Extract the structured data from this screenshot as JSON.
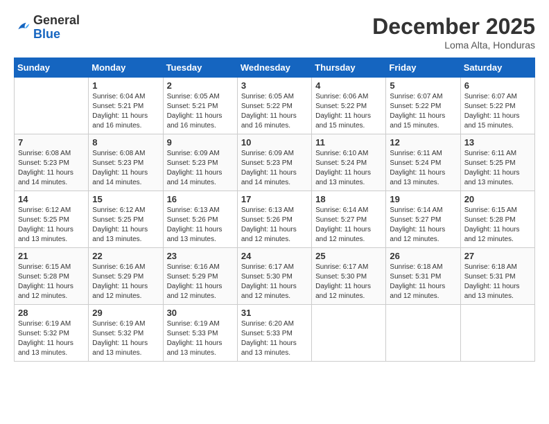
{
  "header": {
    "logo_general": "General",
    "logo_blue": "Blue",
    "month_year": "December 2025",
    "location": "Loma Alta, Honduras"
  },
  "weekdays": [
    "Sunday",
    "Monday",
    "Tuesday",
    "Wednesday",
    "Thursday",
    "Friday",
    "Saturday"
  ],
  "weeks": [
    [
      {
        "day": "",
        "info": ""
      },
      {
        "day": "1",
        "info": "Sunrise: 6:04 AM\nSunset: 5:21 PM\nDaylight: 11 hours and 16 minutes."
      },
      {
        "day": "2",
        "info": "Sunrise: 6:05 AM\nSunset: 5:21 PM\nDaylight: 11 hours and 16 minutes."
      },
      {
        "day": "3",
        "info": "Sunrise: 6:05 AM\nSunset: 5:22 PM\nDaylight: 11 hours and 16 minutes."
      },
      {
        "day": "4",
        "info": "Sunrise: 6:06 AM\nSunset: 5:22 PM\nDaylight: 11 hours and 15 minutes."
      },
      {
        "day": "5",
        "info": "Sunrise: 6:07 AM\nSunset: 5:22 PM\nDaylight: 11 hours and 15 minutes."
      },
      {
        "day": "6",
        "info": "Sunrise: 6:07 AM\nSunset: 5:22 PM\nDaylight: 11 hours and 15 minutes."
      }
    ],
    [
      {
        "day": "7",
        "info": "Sunrise: 6:08 AM\nSunset: 5:23 PM\nDaylight: 11 hours and 14 minutes."
      },
      {
        "day": "8",
        "info": "Sunrise: 6:08 AM\nSunset: 5:23 PM\nDaylight: 11 hours and 14 minutes."
      },
      {
        "day": "9",
        "info": "Sunrise: 6:09 AM\nSunset: 5:23 PM\nDaylight: 11 hours and 14 minutes."
      },
      {
        "day": "10",
        "info": "Sunrise: 6:09 AM\nSunset: 5:23 PM\nDaylight: 11 hours and 14 minutes."
      },
      {
        "day": "11",
        "info": "Sunrise: 6:10 AM\nSunset: 5:24 PM\nDaylight: 11 hours and 13 minutes."
      },
      {
        "day": "12",
        "info": "Sunrise: 6:11 AM\nSunset: 5:24 PM\nDaylight: 11 hours and 13 minutes."
      },
      {
        "day": "13",
        "info": "Sunrise: 6:11 AM\nSunset: 5:25 PM\nDaylight: 11 hours and 13 minutes."
      }
    ],
    [
      {
        "day": "14",
        "info": "Sunrise: 6:12 AM\nSunset: 5:25 PM\nDaylight: 11 hours and 13 minutes."
      },
      {
        "day": "15",
        "info": "Sunrise: 6:12 AM\nSunset: 5:25 PM\nDaylight: 11 hours and 13 minutes."
      },
      {
        "day": "16",
        "info": "Sunrise: 6:13 AM\nSunset: 5:26 PM\nDaylight: 11 hours and 13 minutes."
      },
      {
        "day": "17",
        "info": "Sunrise: 6:13 AM\nSunset: 5:26 PM\nDaylight: 11 hours and 12 minutes."
      },
      {
        "day": "18",
        "info": "Sunrise: 6:14 AM\nSunset: 5:27 PM\nDaylight: 11 hours and 12 minutes."
      },
      {
        "day": "19",
        "info": "Sunrise: 6:14 AM\nSunset: 5:27 PM\nDaylight: 11 hours and 12 minutes."
      },
      {
        "day": "20",
        "info": "Sunrise: 6:15 AM\nSunset: 5:28 PM\nDaylight: 11 hours and 12 minutes."
      }
    ],
    [
      {
        "day": "21",
        "info": "Sunrise: 6:15 AM\nSunset: 5:28 PM\nDaylight: 11 hours and 12 minutes."
      },
      {
        "day": "22",
        "info": "Sunrise: 6:16 AM\nSunset: 5:29 PM\nDaylight: 11 hours and 12 minutes."
      },
      {
        "day": "23",
        "info": "Sunrise: 6:16 AM\nSunset: 5:29 PM\nDaylight: 11 hours and 12 minutes."
      },
      {
        "day": "24",
        "info": "Sunrise: 6:17 AM\nSunset: 5:30 PM\nDaylight: 11 hours and 12 minutes."
      },
      {
        "day": "25",
        "info": "Sunrise: 6:17 AM\nSunset: 5:30 PM\nDaylight: 11 hours and 12 minutes."
      },
      {
        "day": "26",
        "info": "Sunrise: 6:18 AM\nSunset: 5:31 PM\nDaylight: 11 hours and 12 minutes."
      },
      {
        "day": "27",
        "info": "Sunrise: 6:18 AM\nSunset: 5:31 PM\nDaylight: 11 hours and 13 minutes."
      }
    ],
    [
      {
        "day": "28",
        "info": "Sunrise: 6:19 AM\nSunset: 5:32 PM\nDaylight: 11 hours and 13 minutes."
      },
      {
        "day": "29",
        "info": "Sunrise: 6:19 AM\nSunset: 5:32 PM\nDaylight: 11 hours and 13 minutes."
      },
      {
        "day": "30",
        "info": "Sunrise: 6:19 AM\nSunset: 5:33 PM\nDaylight: 11 hours and 13 minutes."
      },
      {
        "day": "31",
        "info": "Sunrise: 6:20 AM\nSunset: 5:33 PM\nDaylight: 11 hours and 13 minutes."
      },
      {
        "day": "",
        "info": ""
      },
      {
        "day": "",
        "info": ""
      },
      {
        "day": "",
        "info": ""
      }
    ]
  ]
}
